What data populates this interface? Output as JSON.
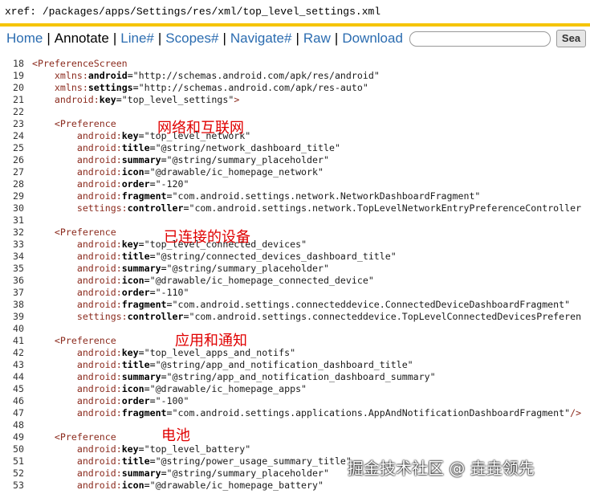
{
  "xref": {
    "label": "xref:",
    "path": "/packages/apps/Settings/res/xml/top_level_settings.xml"
  },
  "nav": {
    "home": "Home",
    "annotate": "Annotate",
    "line": "Line#",
    "scopes": "Scopes#",
    "navigate": "Navigate#",
    "raw": "Raw",
    "download": "Download",
    "search_value": "",
    "search_button": "Sea",
    "separator": "|"
  },
  "code_lines": [
    {
      "n": "18",
      "t": [
        [
          "tag",
          "<PreferenceScreen"
        ]
      ]
    },
    {
      "n": "19",
      "t": [
        [
          "pl",
          "    "
        ],
        [
          "ns",
          "xmlns:"
        ],
        [
          "at",
          "android"
        ],
        [
          "pl",
          "="
        ],
        [
          "val",
          "\"http://schemas.android.com/apk/res/android\""
        ]
      ]
    },
    {
      "n": "20",
      "t": [
        [
          "pl",
          "    "
        ],
        [
          "ns",
          "xmlns:"
        ],
        [
          "at",
          "settings"
        ],
        [
          "pl",
          "="
        ],
        [
          "val",
          "\"http://schemas.android.com/apk/res-auto\""
        ]
      ]
    },
    {
      "n": "21",
      "t": [
        [
          "pl",
          "    "
        ],
        [
          "ns",
          "android:"
        ],
        [
          "at",
          "key"
        ],
        [
          "pl",
          "="
        ],
        [
          "val",
          "\"top_level_settings\""
        ],
        [
          "tag",
          ">"
        ]
      ]
    },
    {
      "n": "22",
      "t": []
    },
    {
      "n": "23",
      "t": [
        [
          "pl",
          "    "
        ],
        [
          "tag",
          "<Preference"
        ]
      ]
    },
    {
      "n": "24",
      "t": [
        [
          "pl",
          "        "
        ],
        [
          "ns",
          "android:"
        ],
        [
          "at",
          "key"
        ],
        [
          "pl",
          "="
        ],
        [
          "val",
          "\"top_level_network\""
        ]
      ]
    },
    {
      "n": "25",
      "t": [
        [
          "pl",
          "        "
        ],
        [
          "ns",
          "android:"
        ],
        [
          "at",
          "title"
        ],
        [
          "pl",
          "="
        ],
        [
          "val",
          "\"@string/network_dashboard_title\""
        ]
      ]
    },
    {
      "n": "26",
      "t": [
        [
          "pl",
          "        "
        ],
        [
          "ns",
          "android:"
        ],
        [
          "at",
          "summary"
        ],
        [
          "pl",
          "="
        ],
        [
          "val",
          "\"@string/summary_placeholder\""
        ]
      ]
    },
    {
      "n": "27",
      "t": [
        [
          "pl",
          "        "
        ],
        [
          "ns",
          "android:"
        ],
        [
          "at",
          "icon"
        ],
        [
          "pl",
          "="
        ],
        [
          "val",
          "\"@drawable/ic_homepage_network\""
        ]
      ]
    },
    {
      "n": "28",
      "t": [
        [
          "pl",
          "        "
        ],
        [
          "ns",
          "android:"
        ],
        [
          "at",
          "order"
        ],
        [
          "pl",
          "="
        ],
        [
          "val",
          "\"-120\""
        ]
      ]
    },
    {
      "n": "29",
      "t": [
        [
          "pl",
          "        "
        ],
        [
          "ns",
          "android:"
        ],
        [
          "at",
          "fragment"
        ],
        [
          "pl",
          "="
        ],
        [
          "val",
          "\"com.android.settings.network.NetworkDashboardFragment\""
        ]
      ]
    },
    {
      "n": "30",
      "t": [
        [
          "pl",
          "        "
        ],
        [
          "ns",
          "settings:"
        ],
        [
          "at",
          "controller"
        ],
        [
          "pl",
          "="
        ],
        [
          "val",
          "\"com.android.settings.network.TopLevelNetworkEntryPreferenceController"
        ]
      ]
    },
    {
      "n": "31",
      "t": []
    },
    {
      "n": "32",
      "t": [
        [
          "pl",
          "    "
        ],
        [
          "tag",
          "<Preference"
        ]
      ]
    },
    {
      "n": "33",
      "t": [
        [
          "pl",
          "        "
        ],
        [
          "ns",
          "android:"
        ],
        [
          "at",
          "key"
        ],
        [
          "pl",
          "="
        ],
        [
          "val",
          "\"top_level_connected_devices\""
        ]
      ]
    },
    {
      "n": "34",
      "t": [
        [
          "pl",
          "        "
        ],
        [
          "ns",
          "android:"
        ],
        [
          "at",
          "title"
        ],
        [
          "pl",
          "="
        ],
        [
          "val",
          "\"@string/connected_devices_dashboard_title\""
        ]
      ]
    },
    {
      "n": "35",
      "t": [
        [
          "pl",
          "        "
        ],
        [
          "ns",
          "android:"
        ],
        [
          "at",
          "summary"
        ],
        [
          "pl",
          "="
        ],
        [
          "val",
          "\"@string/summary_placeholder\""
        ]
      ]
    },
    {
      "n": "36",
      "t": [
        [
          "pl",
          "        "
        ],
        [
          "ns",
          "android:"
        ],
        [
          "at",
          "icon"
        ],
        [
          "pl",
          "="
        ],
        [
          "val",
          "\"@drawable/ic_homepage_connected_device\""
        ]
      ]
    },
    {
      "n": "37",
      "t": [
        [
          "pl",
          "        "
        ],
        [
          "ns",
          "android:"
        ],
        [
          "at",
          "order"
        ],
        [
          "pl",
          "="
        ],
        [
          "val",
          "\"-110\""
        ]
      ]
    },
    {
      "n": "38",
      "t": [
        [
          "pl",
          "        "
        ],
        [
          "ns",
          "android:"
        ],
        [
          "at",
          "fragment"
        ],
        [
          "pl",
          "="
        ],
        [
          "val",
          "\"com.android.settings.connecteddevice.ConnectedDeviceDashboardFragment\""
        ]
      ]
    },
    {
      "n": "39",
      "t": [
        [
          "pl",
          "        "
        ],
        [
          "ns",
          "settings:"
        ],
        [
          "at",
          "controller"
        ],
        [
          "pl",
          "="
        ],
        [
          "val",
          "\"com.android.settings.connecteddevice.TopLevelConnectedDevicesPreferen"
        ]
      ]
    },
    {
      "n": "40",
      "t": []
    },
    {
      "n": "41",
      "t": [
        [
          "pl",
          "    "
        ],
        [
          "tag",
          "<Preference"
        ]
      ]
    },
    {
      "n": "42",
      "t": [
        [
          "pl",
          "        "
        ],
        [
          "ns",
          "android:"
        ],
        [
          "at",
          "key"
        ],
        [
          "pl",
          "="
        ],
        [
          "val",
          "\"top_level_apps_and_notifs\""
        ]
      ]
    },
    {
      "n": "43",
      "t": [
        [
          "pl",
          "        "
        ],
        [
          "ns",
          "android:"
        ],
        [
          "at",
          "title"
        ],
        [
          "pl",
          "="
        ],
        [
          "val",
          "\"@string/app_and_notification_dashboard_title\""
        ]
      ]
    },
    {
      "n": "44",
      "t": [
        [
          "pl",
          "        "
        ],
        [
          "ns",
          "android:"
        ],
        [
          "at",
          "summary"
        ],
        [
          "pl",
          "="
        ],
        [
          "val",
          "\"@string/app_and_notification_dashboard_summary\""
        ]
      ]
    },
    {
      "n": "45",
      "t": [
        [
          "pl",
          "        "
        ],
        [
          "ns",
          "android:"
        ],
        [
          "at",
          "icon"
        ],
        [
          "pl",
          "="
        ],
        [
          "val",
          "\"@drawable/ic_homepage_apps\""
        ]
      ]
    },
    {
      "n": "46",
      "t": [
        [
          "pl",
          "        "
        ],
        [
          "ns",
          "android:"
        ],
        [
          "at",
          "order"
        ],
        [
          "pl",
          "="
        ],
        [
          "val",
          "\"-100\""
        ]
      ]
    },
    {
      "n": "47",
      "t": [
        [
          "pl",
          "        "
        ],
        [
          "ns",
          "android:"
        ],
        [
          "at",
          "fragment"
        ],
        [
          "pl",
          "="
        ],
        [
          "val",
          "\"com.android.settings.applications.AppAndNotificationDashboardFragment\""
        ],
        [
          "tag",
          "/>"
        ]
      ]
    },
    {
      "n": "48",
      "t": []
    },
    {
      "n": "49",
      "t": [
        [
          "pl",
          "    "
        ],
        [
          "tag",
          "<Preference"
        ]
      ]
    },
    {
      "n": "50",
      "t": [
        [
          "pl",
          "        "
        ],
        [
          "ns",
          "android:"
        ],
        [
          "at",
          "key"
        ],
        [
          "pl",
          "="
        ],
        [
          "val",
          "\"top_level_battery\""
        ]
      ]
    },
    {
      "n": "51",
      "t": [
        [
          "pl",
          "        "
        ],
        [
          "ns",
          "android:"
        ],
        [
          "at",
          "title"
        ],
        [
          "pl",
          "="
        ],
        [
          "val",
          "\"@string/power_usage_summary_title\""
        ]
      ]
    },
    {
      "n": "52",
      "t": [
        [
          "pl",
          "        "
        ],
        [
          "ns",
          "android:"
        ],
        [
          "at",
          "summary"
        ],
        [
          "pl",
          "="
        ],
        [
          "val",
          "\"@string/summary_placeholder\""
        ]
      ]
    },
    {
      "n": "53",
      "t": [
        [
          "pl",
          "        "
        ],
        [
          "ns",
          "android:"
        ],
        [
          "at",
          "icon"
        ],
        [
          "pl",
          "="
        ],
        [
          "val",
          "\"@drawable/ic_homepage_battery\""
        ]
      ]
    }
  ],
  "annotations": {
    "network": "网络和互联网",
    "connected": "已连接的设备",
    "apps": "应用和通知",
    "battery": "电池"
  },
  "watermark": "掘金技术社区 @ 垚垚领先",
  "colors": {
    "header_border": "#f5c400",
    "link": "#2b6cb0",
    "annotation": "#e00000",
    "tag": "#8b2a1d"
  }
}
